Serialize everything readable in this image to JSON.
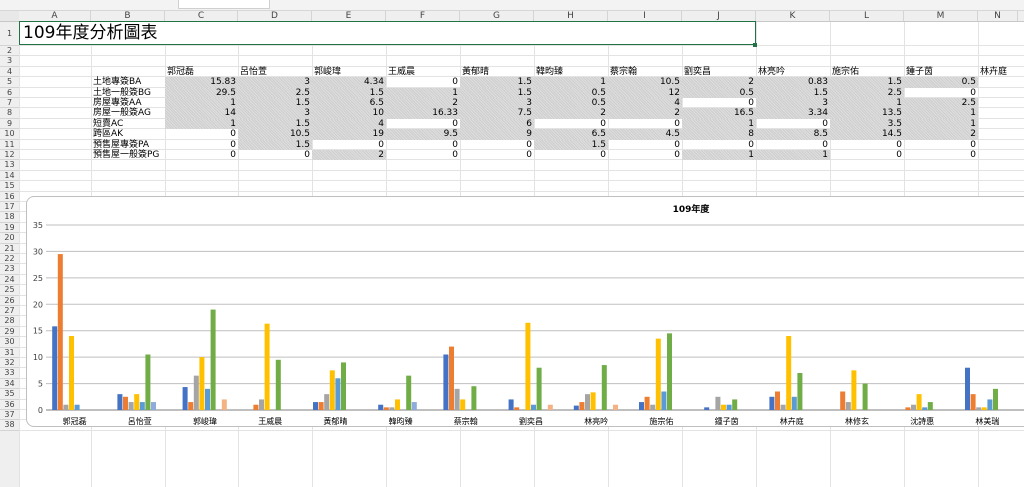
{
  "sheet": {
    "title": "109年度分析圖表",
    "columns": [
      "A",
      "B",
      "C",
      "D",
      "E",
      "F",
      "G",
      "H",
      "I",
      "J",
      "K",
      "L",
      "M",
      "N"
    ],
    "rows": [
      "1",
      "2",
      "3",
      "4",
      "5",
      "6",
      "7",
      "8",
      "9",
      "10",
      "11",
      "12",
      "13",
      "14",
      "15",
      "16",
      "17",
      "18",
      "19",
      "20",
      "21",
      "22",
      "23",
      "24",
      "25",
      "26",
      "27",
      "28",
      "29",
      "30",
      "31",
      "32",
      "33",
      "34",
      "35",
      "36",
      "37",
      "38"
    ]
  },
  "table": {
    "headers": [
      "郭冠磊",
      "呂怡萱",
      "郭峻瑋",
      "王威晨",
      "黃郁晴",
      "韓昀臻",
      "蔡宗翰",
      "劉奕昌",
      "林亮吟",
      "施宗佑",
      "鍾子茵",
      "林卉庭"
    ],
    "rows": [
      {
        "label": "土地專簽BA",
        "values": [
          "15.83",
          "3",
          "4.34",
          "0",
          "1.5",
          "1",
          "10.5",
          "2",
          "0.83",
          "1.5",
          "0.5"
        ]
      },
      {
        "label": "土地一般簽BG",
        "values": [
          "29.5",
          "2.5",
          "1.5",
          "1",
          "1.5",
          "0.5",
          "12",
          "0.5",
          "1.5",
          "2.5",
          "0"
        ]
      },
      {
        "label": "房屋專簽AA",
        "values": [
          "1",
          "1.5",
          "6.5",
          "2",
          "3",
          "0.5",
          "4",
          "0",
          "3",
          "1",
          "2.5"
        ]
      },
      {
        "label": "房屋一般簽AG",
        "values": [
          "14",
          "3",
          "10",
          "16.33",
          "7.5",
          "2",
          "2",
          "16.5",
          "3.34",
          "13.5",
          "1"
        ]
      },
      {
        "label": "短賣AC",
        "values": [
          "1",
          "1.5",
          "4",
          "0",
          "6",
          "0",
          "0",
          "1",
          "0",
          "3.5",
          "1"
        ]
      },
      {
        "label": "跨區AK",
        "values": [
          "0",
          "10.5",
          "19",
          "9.5",
          "9",
          "6.5",
          "4.5",
          "8",
          "8.5",
          "14.5",
          "2"
        ]
      },
      {
        "label": "預售屋專簽PA",
        "values": [
          "0",
          "1.5",
          "0",
          "0",
          "0",
          "1.5",
          "0",
          "0",
          "0",
          "0",
          "0"
        ]
      },
      {
        "label": "預售屋一般簽PG",
        "values": [
          "0",
          "0",
          "2",
          "0",
          "0",
          "0",
          "0",
          "1",
          "1",
          "0",
          "0"
        ]
      }
    ]
  },
  "chart_data": {
    "type": "bar",
    "title": "109年度",
    "ylim": [
      0,
      35
    ],
    "yticks": [
      "0",
      "5",
      "10",
      "15",
      "20",
      "25",
      "30",
      "35"
    ],
    "grid": true,
    "categories": [
      "郭冠磊",
      "呂怡萱",
      "郭峻瑋",
      "王威晨",
      "黃郁晴",
      "韓昀臻",
      "蔡宗翰",
      "劉奕昌",
      "林亮吟",
      "施宗佑",
      "鍾子茵",
      "林卉庭",
      "林修玄",
      "沈詩惠",
      "林美瑞"
    ],
    "series": [
      {
        "color": "#4472c4",
        "values": [
          15.83,
          3,
          4.34,
          0,
          1.5,
          1,
          10.5,
          2,
          0.83,
          1.5,
          0.5,
          2.5,
          0,
          0,
          8
        ]
      },
      {
        "color": "#ed7d31",
        "values": [
          29.5,
          2.5,
          1.5,
          1,
          1.5,
          0.5,
          12,
          0.5,
          1.5,
          2.5,
          0,
          3.5,
          3.5,
          0.5,
          3
        ]
      },
      {
        "color": "#a5a5a5",
        "values": [
          1,
          1.5,
          6.5,
          2,
          3,
          0.5,
          4,
          0,
          3,
          1,
          2.5,
          1,
          1.5,
          1,
          0.5
        ]
      },
      {
        "color": "#ffc000",
        "values": [
          14,
          3,
          10,
          16.33,
          7.5,
          2,
          2,
          16.5,
          3.34,
          13.5,
          1,
          14,
          7.5,
          3,
          0.5
        ]
      },
      {
        "color": "#5b9bd5",
        "values": [
          1,
          1.5,
          4,
          0,
          6,
          0,
          0,
          1,
          0,
          3.5,
          1,
          2.5,
          0,
          0.5,
          2
        ]
      },
      {
        "color": "#70ad47",
        "values": [
          0,
          10.5,
          19,
          9.5,
          9,
          6.5,
          4.5,
          8,
          8.5,
          14.5,
          2,
          7,
          5,
          1.5,
          4
        ]
      },
      {
        "color": "#8faadc",
        "values": [
          0,
          1.5,
          0,
          0,
          0,
          1.5,
          0,
          0,
          0,
          0,
          0,
          0,
          0,
          0,
          0
        ]
      },
      {
        "color": "#f4b183",
        "values": [
          0,
          0,
          2,
          0,
          0,
          0,
          0,
          1,
          1,
          0,
          0,
          0,
          0,
          0,
          0
        ]
      }
    ]
  }
}
